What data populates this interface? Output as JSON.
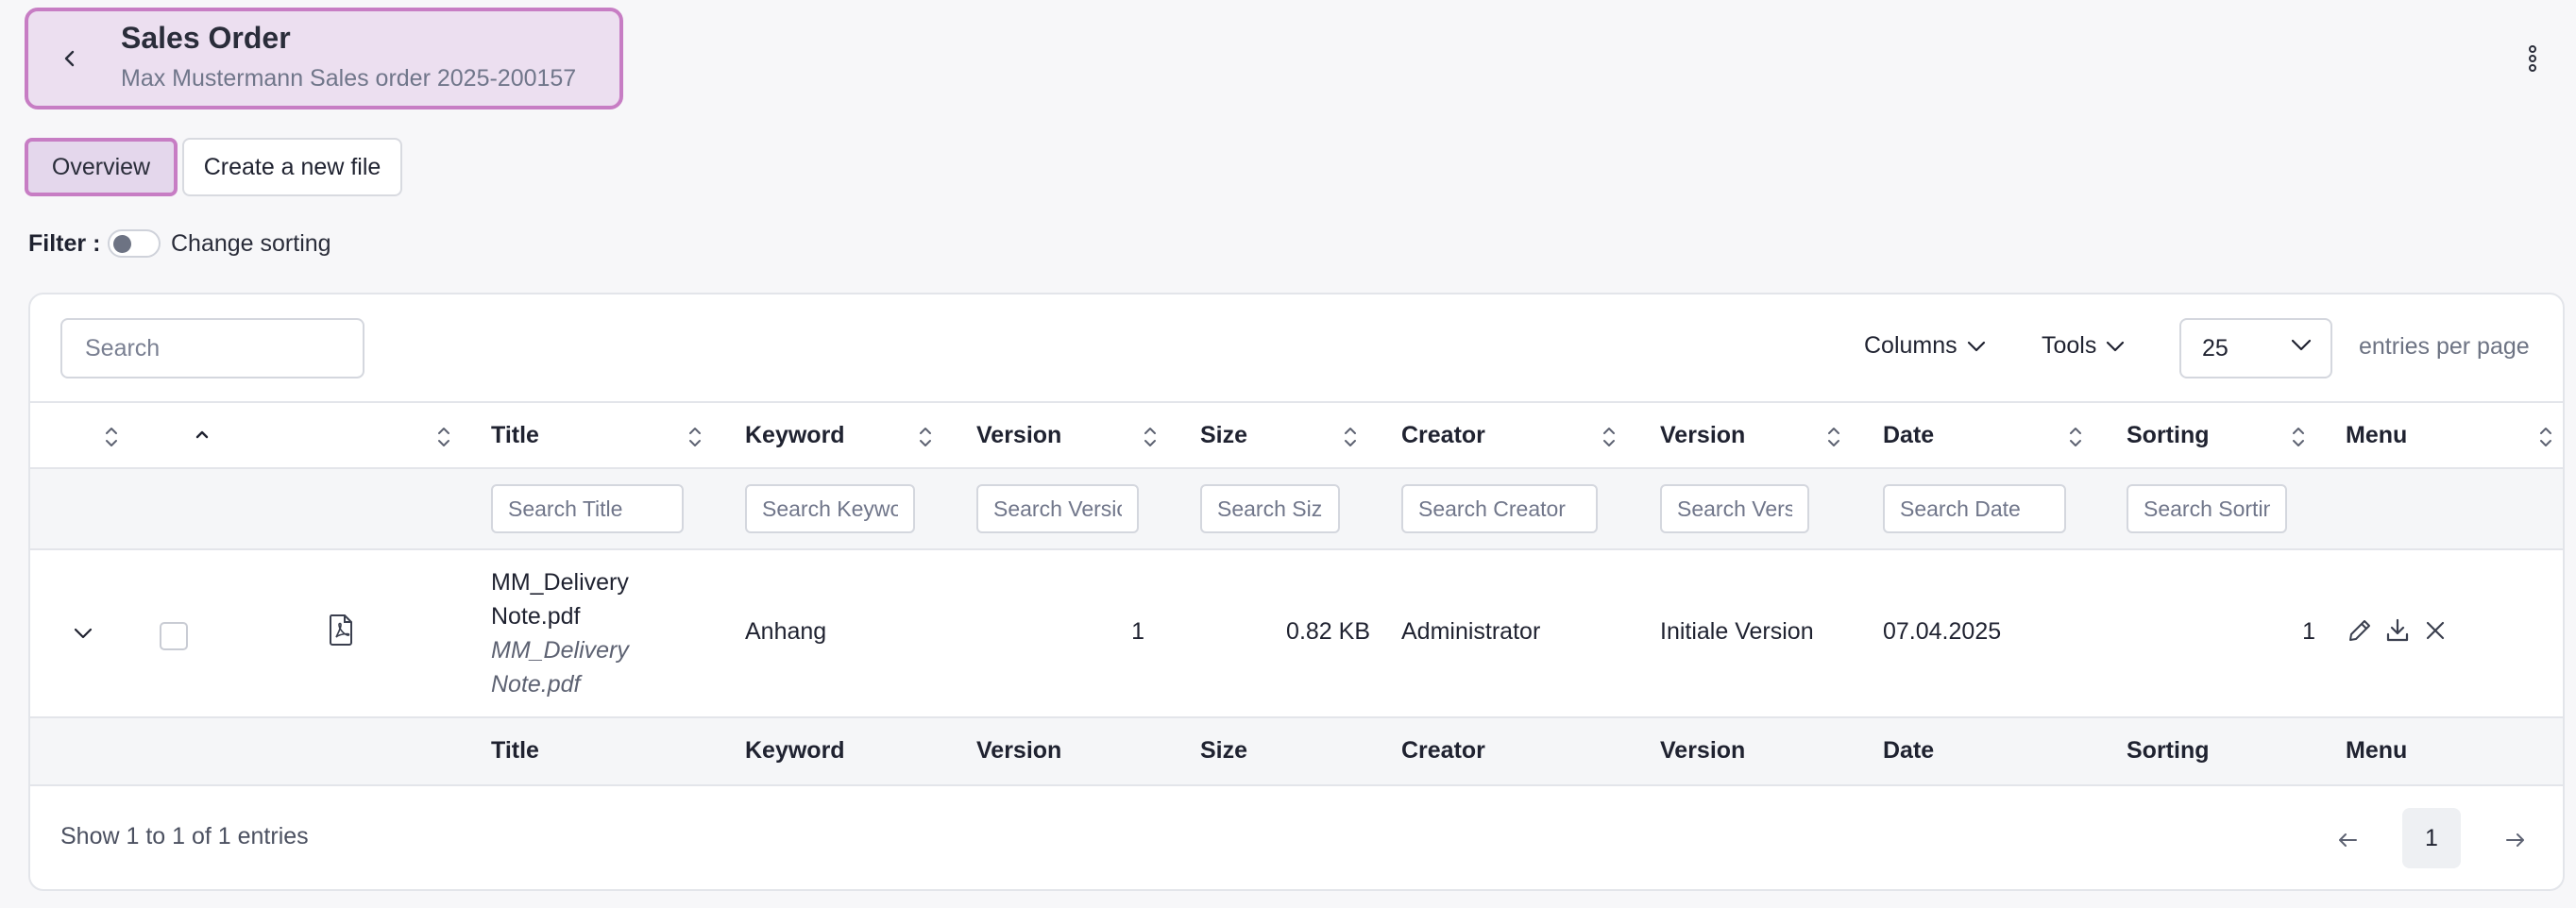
{
  "header": {
    "title": "Sales Order",
    "subtitle": "Max Mustermann Sales order 2025-200157"
  },
  "tabs": [
    {
      "label": "Overview",
      "active": true
    },
    {
      "label": "Create a new file",
      "active": false
    }
  ],
  "filter": {
    "label": "Filter :",
    "toggle_label": "Change sorting",
    "toggle_on": false
  },
  "toolbar": {
    "search_placeholder": "Search",
    "columns_label": "Columns",
    "tools_label": "Tools",
    "per_page_value": "25",
    "entries_label": "entries per page"
  },
  "table": {
    "headers": [
      "Title",
      "Keyword",
      "Version",
      "Size",
      "Creator",
      "Version",
      "Date",
      "Sorting",
      "Menu"
    ],
    "filter_placeholders": [
      "Search Title",
      "Search Keyword",
      "Search Version",
      "Search Size",
      "Search Creator",
      "Search Version",
      "Search Date",
      "Search Sorting"
    ],
    "rows": [
      {
        "title_line1": "MM_Delivery",
        "title_line2": "Note.pdf",
        "subtitle_line1": "MM_Delivery",
        "subtitle_line2": "Note.pdf",
        "keyword": "Anhang",
        "version": "1",
        "size": "0.82 KB",
        "creator": "Administrator",
        "version_name": "Initiale Version",
        "date": "07.04.2025",
        "sorting": "1"
      }
    ],
    "footer": [
      "Title",
      "Keyword",
      "Version",
      "Size",
      "Creator",
      "Version",
      "Date",
      "Sorting",
      "Menu"
    ]
  },
  "pagination": {
    "info": "Show 1 to 1 of 1 entries",
    "current_page": "1"
  },
  "colors": {
    "accent": "#c77dc4",
    "active_fill": "#e4d7ec"
  }
}
